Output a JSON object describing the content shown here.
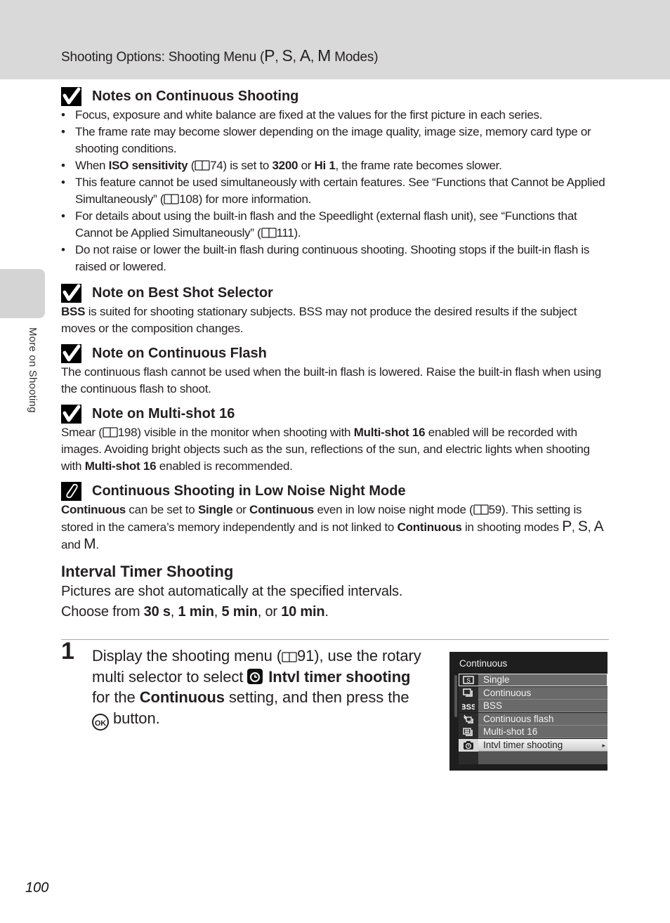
{
  "header": {
    "title_prefix": "Shooting Options: Shooting Menu (",
    "modes": [
      "P",
      "S",
      "A",
      "M"
    ],
    "title_suffix": " Modes)"
  },
  "side_tab": {
    "label": "More on Shooting"
  },
  "notes": [
    {
      "icon": "checkmark-icon",
      "title": "Notes on Continuous Shooting",
      "bullets": [
        [
          {
            "t": "Focus, exposure and white balance are fixed at the values for the first picture in each series."
          }
        ],
        [
          {
            "t": "The frame rate may become slower depending on the image quality, image size, memory card type or shooting conditions."
          }
        ],
        [
          {
            "t": "When "
          },
          {
            "t": "ISO sensitivity",
            "b": true
          },
          {
            "t": " ("
          },
          {
            "ref": "74"
          },
          {
            "t": ") is set to "
          },
          {
            "t": "3200",
            "b": true
          },
          {
            "t": " or "
          },
          {
            "t": "Hi 1",
            "b": true
          },
          {
            "t": ", the frame rate becomes slower."
          }
        ],
        [
          {
            "t": "This feature cannot be used simultaneously with certain features. See “Functions that Cannot be Applied Simultaneously” ("
          },
          {
            "ref": "108"
          },
          {
            "t": ") for more information."
          }
        ],
        [
          {
            "t": "For details about using the built-in flash and the Speedlight (external flash unit), see “Functions that Cannot be Applied Simultaneously” ("
          },
          {
            "ref": "111"
          },
          {
            "t": ")."
          }
        ],
        [
          {
            "t": "Do not raise or lower the built-in flash during continuous shooting. Shooting stops if the built-in flash is raised or lowered."
          }
        ]
      ]
    },
    {
      "icon": "checkmark-icon",
      "title": "Note on Best Shot Selector",
      "body": [
        {
          "t": "BSS",
          "b": true
        },
        {
          "t": " is suited for shooting stationary subjects. BSS may not produce the desired results if the subject moves or the composition changes."
        }
      ]
    },
    {
      "icon": "checkmark-icon",
      "title": "Note on Continuous Flash",
      "body": [
        {
          "t": "The continuous flash cannot be used when the built-in flash is lowered. Raise the built-in flash when using the continuous flash to shoot."
        }
      ]
    },
    {
      "icon": "checkmark-icon",
      "title": "Note on Multi-shot 16",
      "body": [
        {
          "t": "Smear ("
        },
        {
          "ref": "198"
        },
        {
          "t": ") visible in the monitor when shooting with "
        },
        {
          "t": "Multi-shot 16",
          "b": true
        },
        {
          "t": " enabled will be recorded with images. Avoiding bright objects such as the sun, reflections of the sun, and electric lights when shooting with "
        },
        {
          "t": "Multi-shot 16",
          "b": true
        },
        {
          "t": " enabled is recommended."
        }
      ]
    },
    {
      "icon": "paperclip-icon",
      "title": "Continuous Shooting in Low Noise Night Mode",
      "body": [
        {
          "t": "Continuous",
          "b": true
        },
        {
          "t": " can be set to "
        },
        {
          "t": "Single",
          "b": true
        },
        {
          "t": " or "
        },
        {
          "t": "Continuous",
          "b": true
        },
        {
          "t": " even in low noise night mode ("
        },
        {
          "ref": "59"
        },
        {
          "t": "). This setting is stored in the camera’s memory independently and is not linked to "
        },
        {
          "t": "Continuous",
          "b": true
        },
        {
          "t": " in shooting modes "
        },
        {
          "t": "P",
          "m": true
        },
        {
          "t": ", "
        },
        {
          "t": "S",
          "m": true
        },
        {
          "t": ", "
        },
        {
          "t": "A",
          "m": true
        },
        {
          "t": " and "
        },
        {
          "t": "M",
          "m": true
        },
        {
          "t": "."
        }
      ]
    }
  ],
  "section": {
    "title": "Interval Timer Shooting",
    "line1": "Pictures are shot automatically at the specified intervals.",
    "line2": [
      {
        "t": "Choose from "
      },
      {
        "t": "30 s",
        "b": true
      },
      {
        "t": ", "
      },
      {
        "t": "1 min",
        "b": true
      },
      {
        "t": ", "
      },
      {
        "t": "5 min",
        "b": true
      },
      {
        "t": ", or "
      },
      {
        "t": "10 min",
        "b": true
      },
      {
        "t": "."
      }
    ]
  },
  "step": {
    "number": "1",
    "text": [
      {
        "t": "Display the shooting menu ("
      },
      {
        "ref": "91"
      },
      {
        "t": "), use the rotary multi selector to select "
      },
      {
        "glyph": "interval-timer"
      },
      {
        "t": " Intvl timer shooting",
        "b": true
      },
      {
        "t": " for the "
      },
      {
        "t": "Continuous",
        "b": true
      },
      {
        "t": " setting, and then press the "
      },
      {
        "glyph": "ok"
      },
      {
        "t": " button."
      }
    ]
  },
  "camera_menu": {
    "title": "Continuous",
    "items": [
      {
        "icon": "single-frame-icon",
        "label": "Single",
        "state": "selected"
      },
      {
        "icon": "continuous-icon",
        "label": "Continuous",
        "state": ""
      },
      {
        "icon": "bss-icon",
        "label": "BSS",
        "state": ""
      },
      {
        "icon": "continuous-flash-icon",
        "label": "Continuous flash",
        "state": ""
      },
      {
        "icon": "multi-shot-icon",
        "label": "Multi-shot 16",
        "state": ""
      },
      {
        "icon": "interval-timer-icon",
        "label": "Intvl timer shooting",
        "state": "highlighted",
        "arrow": "▸"
      }
    ]
  },
  "page_number": "100"
}
